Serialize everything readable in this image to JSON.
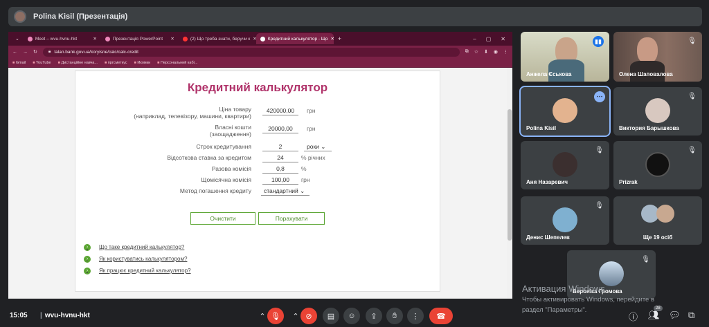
{
  "presenter": {
    "title": "Polina Kisil (Презентація)"
  },
  "browser": {
    "tabs": [
      {
        "label": "Meet – wvu-hvnu-hkt",
        "active": false
      },
      {
        "label": "Презентація PowerPoint",
        "active": false
      },
      {
        "label": "(2) Що треба знати, беручи к",
        "active": false
      },
      {
        "label": "Кредитний калькулятор - Що",
        "active": true
      }
    ],
    "url": "talan.bank.gov.ua/koryisne/calc/calc-credit",
    "bookmarks": [
      "Gmail",
      "YouTube",
      "Дистанційне навча...",
      "пргсметкус",
      "Икомки",
      "Персональний кабі..."
    ]
  },
  "calculator": {
    "title": "Кредитний калькулятор",
    "rows": [
      {
        "label_line1": "Ціна товару",
        "label_line2": "(наприклад, телевізору, машини, квартири)",
        "value": "420000,00",
        "unit": "грн"
      },
      {
        "label_line1": "Власні кошти",
        "label_line2": "(заощадження)",
        "value": "20000,00",
        "unit": "грн"
      },
      {
        "label_line1": "Строк кредитування",
        "label_line2": "",
        "value": "2",
        "select": "роки ⌄"
      },
      {
        "label_line1": "Відсоткова ставка за кредитом",
        "label_line2": "",
        "value": "24",
        "unit": "% річних"
      },
      {
        "label_line1": "Разова комісія",
        "label_line2": "",
        "value": "0,8",
        "unit": "%"
      },
      {
        "label_line1": "Щомісячна комісія",
        "label_line2": "",
        "value": "100,00",
        "unit": "грн"
      },
      {
        "label_line1": "Метод погашення кредиту",
        "label_line2": "",
        "select": "стандартний ⌄"
      }
    ],
    "clear_button": "Очистити",
    "calc_button": "Порахувати",
    "links": [
      "Що таке кредитний калькулятор?",
      "Як користуватись калькулятором?",
      "Як працює кредитний калькулятор?"
    ]
  },
  "participants": [
    {
      "name": "Анжела Єськова",
      "muted": false,
      "speaking": true
    },
    {
      "name": "Олена Шаповалова",
      "muted": true
    },
    {
      "name": "Polina Kisil",
      "muted": false,
      "selected": true
    },
    {
      "name": "Виктория Барышкова",
      "muted": true
    },
    {
      "name": "Аня Назаревич",
      "muted": true
    },
    {
      "name": "Prizrak",
      "muted": true
    },
    {
      "name": "Денис Шепелев",
      "muted": true
    },
    {
      "name": "Ще 19 осіб",
      "muted": false
    },
    {
      "name": "Вероніка Громова",
      "muted": true
    }
  ],
  "watermark": {
    "line1": "Активация Windows",
    "line2": "Чтобы активировать Windows, перейдите в",
    "line3": "раздел \"Параметры\"."
  },
  "bottom": {
    "time": "15:05",
    "separator": "|",
    "meeting_code": "wvu-hvnu-hkt",
    "people_count": "28"
  }
}
